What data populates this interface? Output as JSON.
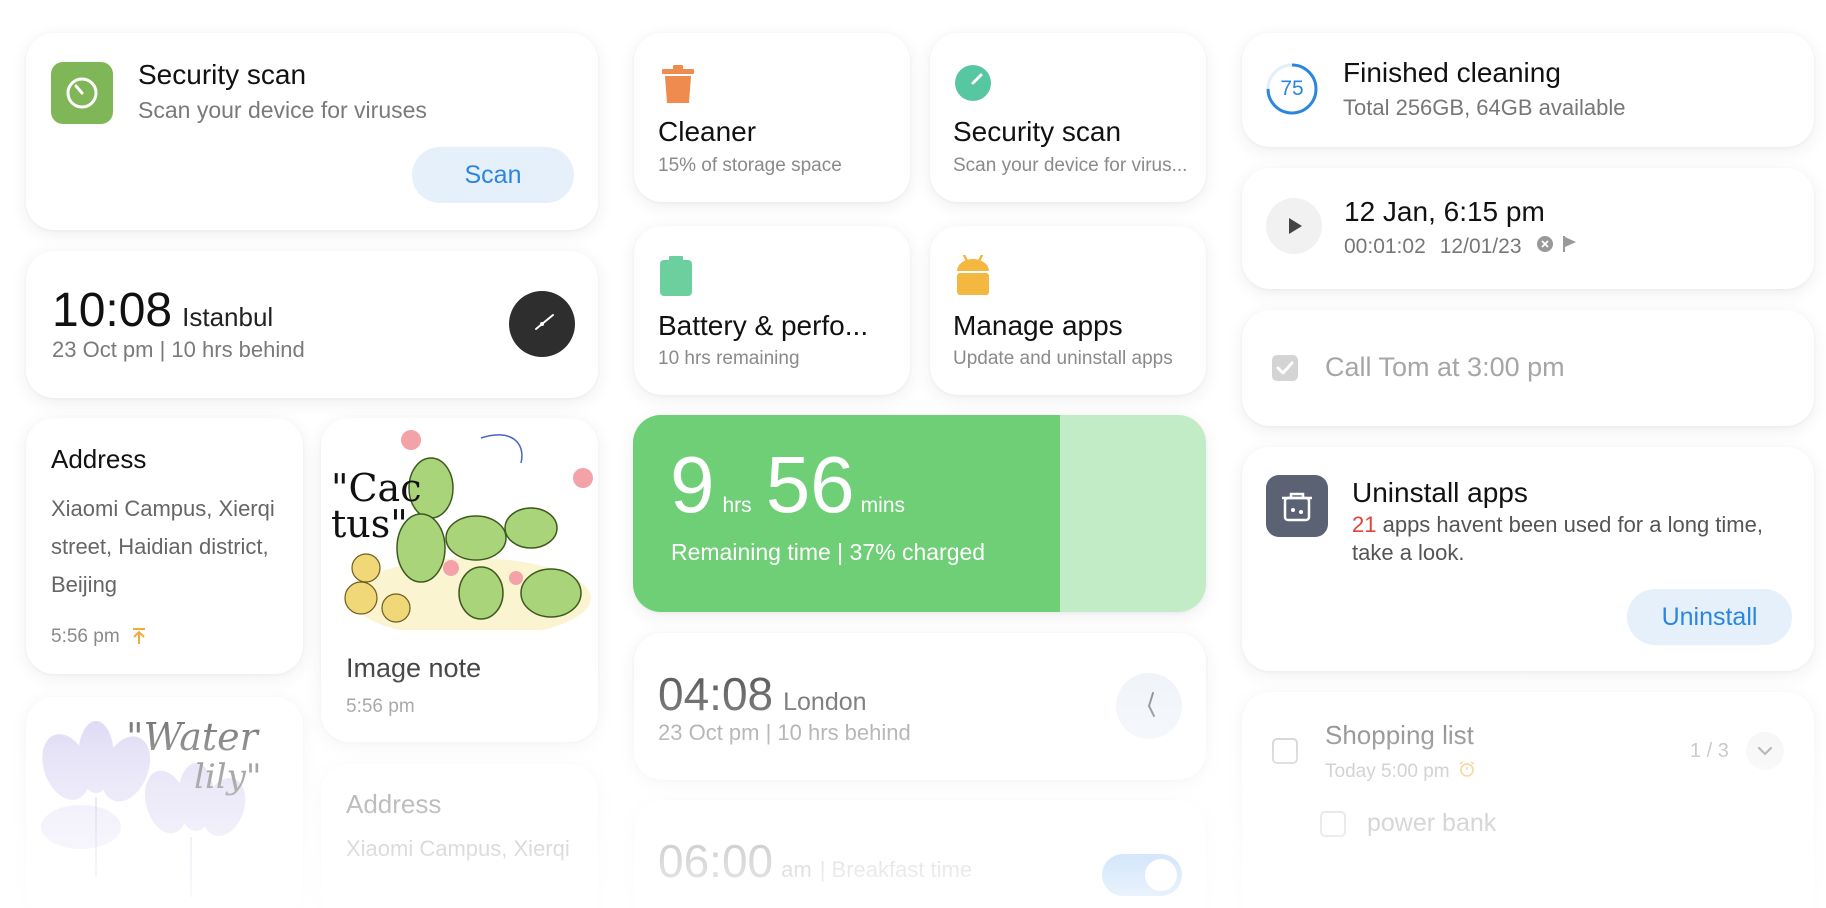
{
  "security_card": {
    "title": "Security scan",
    "subtitle": "Scan your device for viruses",
    "button": "Scan",
    "icon": "gauge-icon"
  },
  "istanbul_clock": {
    "time": "10:08",
    "city": "Istanbul",
    "detail": "23 Oct pm | 10 hrs behind"
  },
  "address_card": {
    "title": "Address",
    "body": "Xiaomi Campus, Xierqi street, Haidian district, Beijing",
    "time": "5:56 pm"
  },
  "image_note": {
    "title": "Image note",
    "time": "5:56 pm",
    "sketch_text": "\"Cac tus\""
  },
  "water_lily": {
    "sketch_text_1": "\"Water",
    "sketch_text_2": "lily\""
  },
  "address_card_2": {
    "title": "Address",
    "body": "Xiaomi Campus, Xierqi"
  },
  "cleaner": {
    "title": "Cleaner",
    "subtitle": "15% of storage space"
  },
  "security_small": {
    "title": "Security scan",
    "subtitle": "Scan your device for virus..."
  },
  "battery_tile": {
    "title": "Battery & perfo...",
    "subtitle": "10 hrs remaining"
  },
  "manage_apps": {
    "title": "Manage apps",
    "subtitle": "Update and uninstall apps"
  },
  "battery_big": {
    "hours": "9",
    "hours_unit": "hrs",
    "mins": "56",
    "mins_unit": "mins",
    "detail": "Remaining time | 37% charged",
    "charged_percent": 37
  },
  "london_clock": {
    "time": "04:08",
    "city": "London",
    "detail": "23 Oct pm | 10 hrs behind"
  },
  "alarm": {
    "time": "06:00",
    "ampm": "am",
    "label": "| Breakfast time",
    "enabled": true
  },
  "finished_cleaning": {
    "progress": "75",
    "title": "Finished cleaning",
    "subtitle": "Total 256GB, 64GB available"
  },
  "recording": {
    "title": "12 Jan, 6:15 pm",
    "duration": "00:01:02",
    "date": "12/01/23"
  },
  "todo": {
    "text": "Call Tom at 3:00 pm",
    "checked": true
  },
  "uninstall": {
    "title": "Uninstall apps",
    "count": "21",
    "message": " apps havent been used for a long time, take a look.",
    "button": "Uninstall"
  },
  "shopping": {
    "title": "Shopping list",
    "time": "Today 5:00 pm",
    "count": "1 / 3",
    "item": "power bank"
  },
  "colors": {
    "accent_blue": "#2a86e0",
    "green": "#6fcf76",
    "orange": "#ef8b4f",
    "teal": "#56c7a0",
    "yellow": "#f4b740"
  }
}
